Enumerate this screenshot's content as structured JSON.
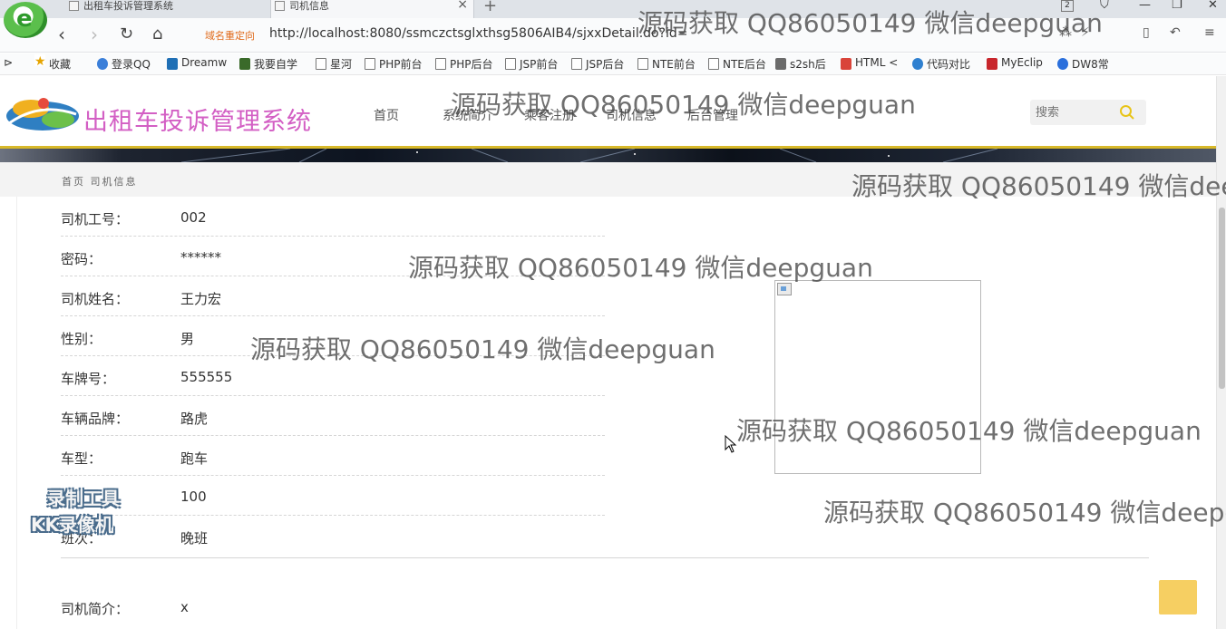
{
  "browser": {
    "tabs": [
      {
        "title": "出租车投诉管理系统"
      },
      {
        "title": "司机信息"
      }
    ],
    "tab_close": "×",
    "new_tab": "+",
    "window_count": "2",
    "redirect_label": "域名重定向",
    "url": "http://localhost:8080/ssmczctsglxthsg5806AIB4/sjxxDetail.do?id=7",
    "bookmarks": [
      "收藏",
      "登录QQ",
      "Dreamw",
      "我要自学",
      "星河",
      "PHP前台",
      "PHP后台",
      "JSP前台",
      "JSP后台",
      "NTE前台",
      "NTE后台",
      "s2sh后",
      "HTML <",
      "代码对比",
      "MyEclip",
      "DW8常"
    ]
  },
  "site": {
    "title": "出租车投诉管理系统",
    "menu": [
      "首页",
      "系统简介",
      "乘客注册",
      "司机信息",
      "后台管理"
    ],
    "search_placeholder": "搜索"
  },
  "breadcrumb": "首页 司机信息",
  "driver": {
    "fields": [
      {
        "label": "司机工号：",
        "value": "002"
      },
      {
        "label": "密码：",
        "value": "******"
      },
      {
        "label": "司机姓名：",
        "value": "王力宏"
      },
      {
        "label": "性别：",
        "value": "男"
      },
      {
        "label": "车牌号：",
        "value": "555555"
      },
      {
        "label": "车辆品牌：",
        "value": "路虎"
      },
      {
        "label": "车型：",
        "value": "跑车"
      },
      {
        "label": "：",
        "value": "100"
      },
      {
        "label": "班次：",
        "value": "晚班"
      }
    ],
    "bio_label": "司机简介：",
    "bio_value": "x"
  },
  "overlays": {
    "watermark_text": "源码获取 QQ86050149 微信deepguan",
    "recorder_line1": "录制工具",
    "recorder_line2": "KK录像机"
  },
  "colors": {
    "site_title": "#d35fc4",
    "header_rule": "#d8b92a",
    "back_to_top": "#f6cf62",
    "redirect_label": "#e06a1a"
  }
}
